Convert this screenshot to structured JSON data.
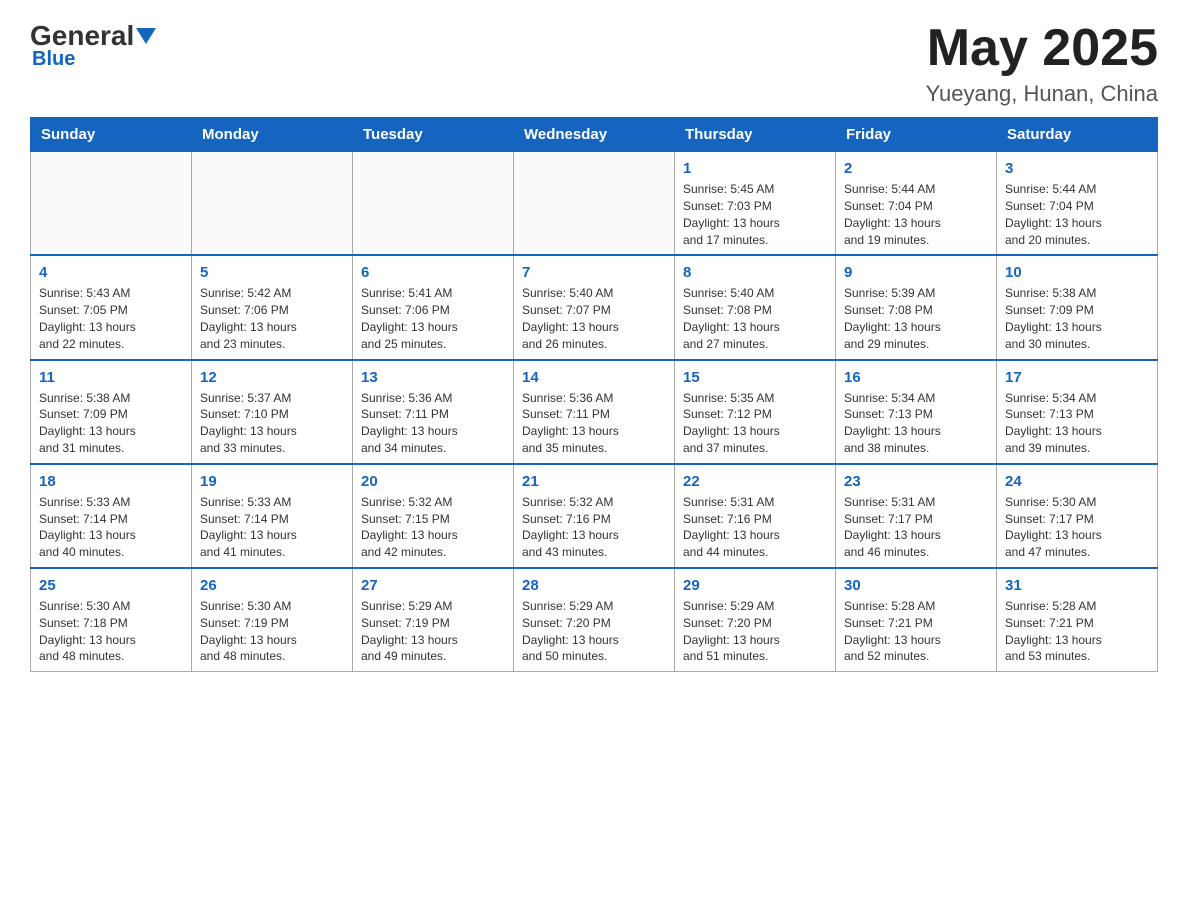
{
  "header": {
    "logo_general": "General",
    "logo_blue": "Blue",
    "month_year": "May 2025",
    "location": "Yueyang, Hunan, China"
  },
  "days_of_week": [
    "Sunday",
    "Monday",
    "Tuesday",
    "Wednesday",
    "Thursday",
    "Friday",
    "Saturday"
  ],
  "weeks": [
    [
      {
        "day": "",
        "info": ""
      },
      {
        "day": "",
        "info": ""
      },
      {
        "day": "",
        "info": ""
      },
      {
        "day": "",
        "info": ""
      },
      {
        "day": "1",
        "info": "Sunrise: 5:45 AM\nSunset: 7:03 PM\nDaylight: 13 hours\nand 17 minutes."
      },
      {
        "day": "2",
        "info": "Sunrise: 5:44 AM\nSunset: 7:04 PM\nDaylight: 13 hours\nand 19 minutes."
      },
      {
        "day": "3",
        "info": "Sunrise: 5:44 AM\nSunset: 7:04 PM\nDaylight: 13 hours\nand 20 minutes."
      }
    ],
    [
      {
        "day": "4",
        "info": "Sunrise: 5:43 AM\nSunset: 7:05 PM\nDaylight: 13 hours\nand 22 minutes."
      },
      {
        "day": "5",
        "info": "Sunrise: 5:42 AM\nSunset: 7:06 PM\nDaylight: 13 hours\nand 23 minutes."
      },
      {
        "day": "6",
        "info": "Sunrise: 5:41 AM\nSunset: 7:06 PM\nDaylight: 13 hours\nand 25 minutes."
      },
      {
        "day": "7",
        "info": "Sunrise: 5:40 AM\nSunset: 7:07 PM\nDaylight: 13 hours\nand 26 minutes."
      },
      {
        "day": "8",
        "info": "Sunrise: 5:40 AM\nSunset: 7:08 PM\nDaylight: 13 hours\nand 27 minutes."
      },
      {
        "day": "9",
        "info": "Sunrise: 5:39 AM\nSunset: 7:08 PM\nDaylight: 13 hours\nand 29 minutes."
      },
      {
        "day": "10",
        "info": "Sunrise: 5:38 AM\nSunset: 7:09 PM\nDaylight: 13 hours\nand 30 minutes."
      }
    ],
    [
      {
        "day": "11",
        "info": "Sunrise: 5:38 AM\nSunset: 7:09 PM\nDaylight: 13 hours\nand 31 minutes."
      },
      {
        "day": "12",
        "info": "Sunrise: 5:37 AM\nSunset: 7:10 PM\nDaylight: 13 hours\nand 33 minutes."
      },
      {
        "day": "13",
        "info": "Sunrise: 5:36 AM\nSunset: 7:11 PM\nDaylight: 13 hours\nand 34 minutes."
      },
      {
        "day": "14",
        "info": "Sunrise: 5:36 AM\nSunset: 7:11 PM\nDaylight: 13 hours\nand 35 minutes."
      },
      {
        "day": "15",
        "info": "Sunrise: 5:35 AM\nSunset: 7:12 PM\nDaylight: 13 hours\nand 37 minutes."
      },
      {
        "day": "16",
        "info": "Sunrise: 5:34 AM\nSunset: 7:13 PM\nDaylight: 13 hours\nand 38 minutes."
      },
      {
        "day": "17",
        "info": "Sunrise: 5:34 AM\nSunset: 7:13 PM\nDaylight: 13 hours\nand 39 minutes."
      }
    ],
    [
      {
        "day": "18",
        "info": "Sunrise: 5:33 AM\nSunset: 7:14 PM\nDaylight: 13 hours\nand 40 minutes."
      },
      {
        "day": "19",
        "info": "Sunrise: 5:33 AM\nSunset: 7:14 PM\nDaylight: 13 hours\nand 41 minutes."
      },
      {
        "day": "20",
        "info": "Sunrise: 5:32 AM\nSunset: 7:15 PM\nDaylight: 13 hours\nand 42 minutes."
      },
      {
        "day": "21",
        "info": "Sunrise: 5:32 AM\nSunset: 7:16 PM\nDaylight: 13 hours\nand 43 minutes."
      },
      {
        "day": "22",
        "info": "Sunrise: 5:31 AM\nSunset: 7:16 PM\nDaylight: 13 hours\nand 44 minutes."
      },
      {
        "day": "23",
        "info": "Sunrise: 5:31 AM\nSunset: 7:17 PM\nDaylight: 13 hours\nand 46 minutes."
      },
      {
        "day": "24",
        "info": "Sunrise: 5:30 AM\nSunset: 7:17 PM\nDaylight: 13 hours\nand 47 minutes."
      }
    ],
    [
      {
        "day": "25",
        "info": "Sunrise: 5:30 AM\nSunset: 7:18 PM\nDaylight: 13 hours\nand 48 minutes."
      },
      {
        "day": "26",
        "info": "Sunrise: 5:30 AM\nSunset: 7:19 PM\nDaylight: 13 hours\nand 48 minutes."
      },
      {
        "day": "27",
        "info": "Sunrise: 5:29 AM\nSunset: 7:19 PM\nDaylight: 13 hours\nand 49 minutes."
      },
      {
        "day": "28",
        "info": "Sunrise: 5:29 AM\nSunset: 7:20 PM\nDaylight: 13 hours\nand 50 minutes."
      },
      {
        "day": "29",
        "info": "Sunrise: 5:29 AM\nSunset: 7:20 PM\nDaylight: 13 hours\nand 51 minutes."
      },
      {
        "day": "30",
        "info": "Sunrise: 5:28 AM\nSunset: 7:21 PM\nDaylight: 13 hours\nand 52 minutes."
      },
      {
        "day": "31",
        "info": "Sunrise: 5:28 AM\nSunset: 7:21 PM\nDaylight: 13 hours\nand 53 minutes."
      }
    ]
  ]
}
